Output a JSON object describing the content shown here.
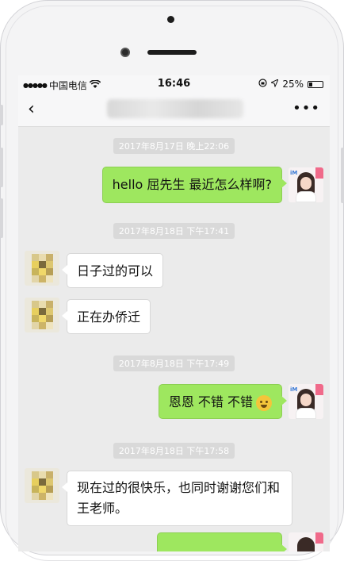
{
  "status_bar": {
    "signal": "●●●●●",
    "carrier": "中国电信",
    "wifi_icon": "wifi-icon",
    "time": "16:46",
    "battery": "25%",
    "battery_level": 0.25
  },
  "nav": {
    "back_icon": "‹",
    "more_icon": "•••"
  },
  "messages": [
    {
      "type": "timestamp",
      "text": "2017年8月17日 晚上22:06"
    },
    {
      "type": "out",
      "text": "hello  屈先生 最近怎么样啊?"
    },
    {
      "type": "timestamp",
      "text": "2017年8月18日 下午17:41"
    },
    {
      "type": "in",
      "text": "日子过的可以"
    },
    {
      "type": "in",
      "text": "正在办侨迁"
    },
    {
      "type": "timestamp",
      "text": "2017年8月18日 下午17:49"
    },
    {
      "type": "out",
      "text": "恩恩   不错 不错",
      "emoji": "smiling-face-icon"
    },
    {
      "type": "timestamp",
      "text": "2017年8月18日 下午17:58"
    },
    {
      "type": "in",
      "text": " 现在过的很快乐，也同时谢谢您们和王老师。"
    }
  ],
  "colors": {
    "outgoing_bubble": "#9ee75f",
    "incoming_bubble": "#ffffff",
    "chat_background": "#ebebeb",
    "timestamp_bg": "#d9d9d9"
  }
}
